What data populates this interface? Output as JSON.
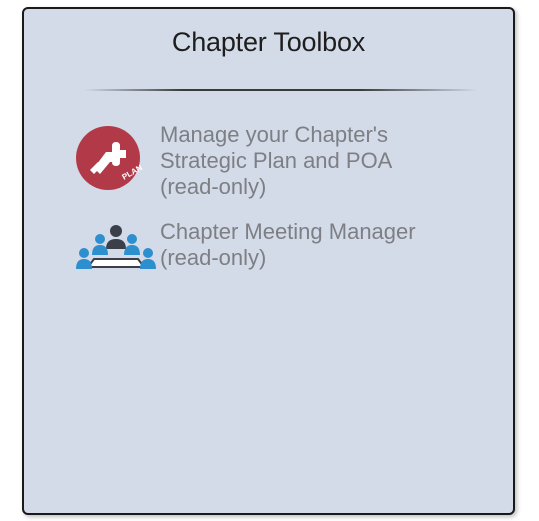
{
  "toolbox": {
    "title": "Chapter Toolbox",
    "items": [
      {
        "icon": "strategic-plan-icon",
        "lines": [
          "Manage your Chapter's",
          "Strategic Plan and POA",
          "(read-only)"
        ],
        "icon_color": "#b23a48"
      },
      {
        "icon": "meeting-icon",
        "lines": [
          "Chapter Meeting Manager",
          "(read-only)"
        ],
        "icon_color": "#2e8fcf"
      }
    ],
    "plan_badge": "PLAN"
  },
  "colors": {
    "panel_background": "#d3dbe8",
    "panel_border": "#1a1a1a",
    "item_text": "#7d7f84"
  }
}
